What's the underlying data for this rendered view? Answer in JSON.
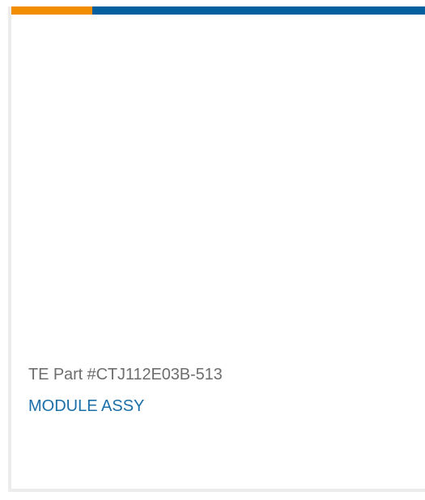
{
  "card": {
    "part_number": "TE Part #CTJ112E03B-513",
    "title": "MODULE ASSY"
  },
  "colors": {
    "accent_orange": "#f28c00",
    "accent_blue": "#04609e",
    "part_number_text": "#6e6e6e",
    "title_text": "#1a6fa8"
  }
}
